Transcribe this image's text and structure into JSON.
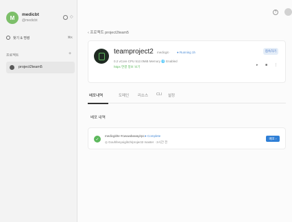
{
  "sidebar": {
    "user": {
      "avatar_letter": "M",
      "name": "medicbt",
      "handle": "@medicbt"
    },
    "search": {
      "label": "찾기 & 명령",
      "shortcut": "⌘K"
    },
    "section_label": "프로젝트",
    "section_add": "+",
    "projects": [
      {
        "label": "project2team5"
      }
    ]
  },
  "topbar": {
    "help_icon": "?"
  },
  "breadcrumb": "‹ 프로젝트 project2team5",
  "project_card": {
    "title": "teamproject2",
    "meta": "medicgit ·",
    "status": "● Running 1h",
    "specs": "0.2 vCore CPU   512.0MiB Memory   🌐 Enabled",
    "link": "https 연결 정보 보기",
    "action_label": "접속하기",
    "controls": [
      "▸",
      "■",
      "⋮"
    ]
  },
  "tabs": [
    {
      "label": "배포내역",
      "active": true
    },
    {
      "label": "도메인",
      "active": false
    },
    {
      "label": "리소스",
      "active": false
    },
    {
      "label": "CLI",
      "active": false
    },
    {
      "label": "설정",
      "active": false
    }
  ],
  "history": {
    "title": "배포 내역",
    "items": [
      {
        "name": "medicgit/te  #cwuwdwwayirpc",
        "status": "● Complete",
        "detail": "◎ Gouhfeeyoig/itch/project2   master  · 2시간 전",
        "button_label": "배포 ›"
      }
    ]
  },
  "colors": {
    "accent_green": "#5cb85c",
    "accent_blue": "#2f7fd6"
  }
}
